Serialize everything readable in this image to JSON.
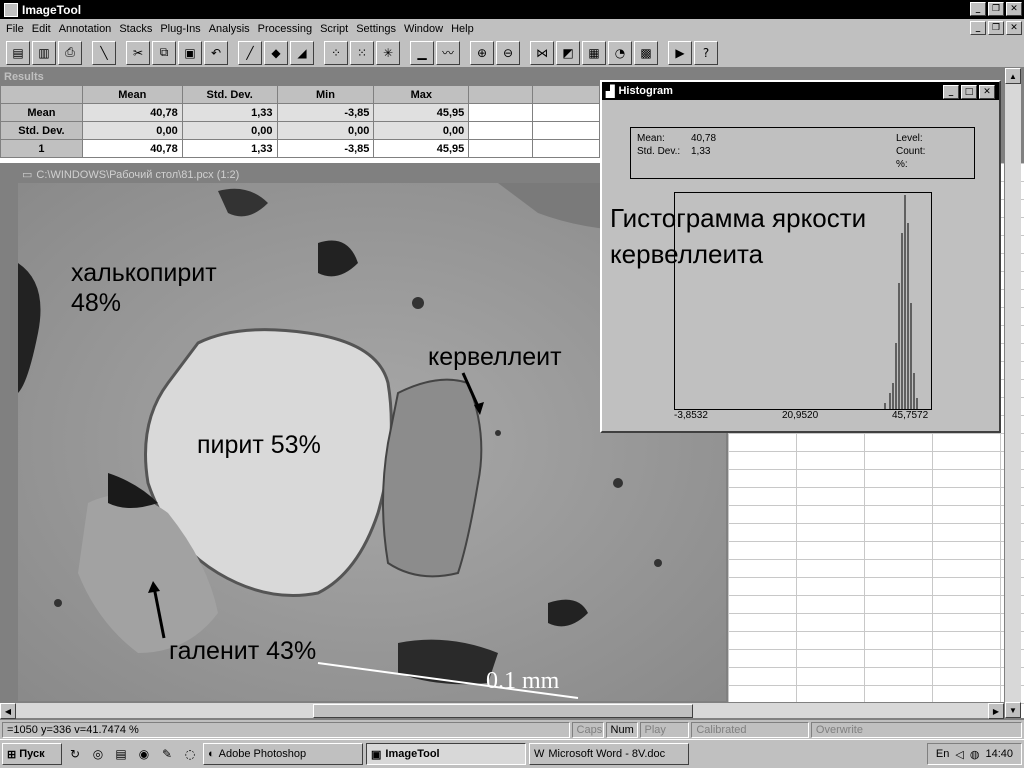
{
  "app": {
    "title": "ImageTool"
  },
  "menu": [
    "File",
    "Edit",
    "Annotation",
    "Stacks",
    "Plug-Ins",
    "Analysis",
    "Processing",
    "Script",
    "Settings",
    "Window",
    "Help"
  ],
  "toolbar_icons": [
    "new-icon",
    "open-icon",
    "print-icon",
    "line-icon",
    "cut-icon",
    "copy-icon",
    "paste-icon",
    "undo-icon",
    "pencil-icon",
    "fill-icon",
    "erase-icon",
    "dots-icon",
    "noise-icon",
    "sharpen-icon",
    "histogram-icon",
    "profile-icon",
    "zoom-in-icon",
    "zoom-out-icon",
    "link-icon",
    "contrast-icon",
    "calculator-icon",
    "pie-icon",
    "grid-icon",
    "play-icon",
    "help-icon"
  ],
  "results": {
    "title": "Results",
    "columns": [
      "",
      "Mean",
      "Std. Dev.",
      "Min",
      "Max"
    ],
    "rows": [
      {
        "label": "Mean",
        "values": [
          "40,78",
          "1,33",
          "-3,85",
          "45,95"
        ]
      },
      {
        "label": "Std. Dev.",
        "values": [
          "0,00",
          "0,00",
          "0,00",
          "0,00"
        ]
      },
      {
        "label": "1",
        "values": [
          "40,78",
          "1,33",
          "-3,85",
          "45,95"
        ]
      }
    ]
  },
  "image_window": {
    "title": "C:\\WINDOWS\\Рабочий стол\\81.pcx (1:2)",
    "labels": {
      "chalcopyrite": "халькопирит\n48%",
      "pyrite": "пирит 53%",
      "kervelleite": "кервеллеит",
      "galenite": "галенит 43%",
      "scale": "0.1 mm"
    }
  },
  "histogram": {
    "title": "Histogram",
    "mean_label": "Mean:",
    "mean_value": "40,78",
    "std_label": "Std. Dev.:",
    "std_value": "1,33",
    "level_label": "Level:",
    "count_label": "Count:",
    "pct_label": "%:",
    "caption": "Гистограмма яркости\nкервеллеита",
    "axis": {
      "min": "-3,8532",
      "mid": "20,9520",
      "max": "45,7572"
    }
  },
  "status": {
    "coords": "=1050 y=336 v=41.7474 %",
    "caps": "Caps",
    "num": "Num",
    "play": "Play",
    "calibrated": "Calibrated",
    "overwrite": "Overwrite"
  },
  "taskbar": {
    "start": "Пуск",
    "tasks": [
      "Adobe Photoshop",
      "ImageTool",
      "Microsoft Word - 8V.doc"
    ],
    "lang": "En",
    "clock": "14:40"
  }
}
